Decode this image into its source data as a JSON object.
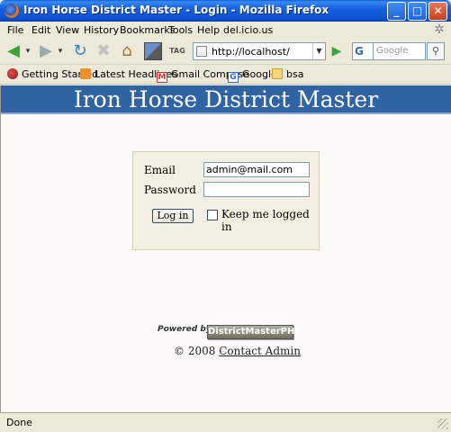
{
  "window": {
    "title": "Iron Horse District Master - Login - Mozilla Firefox",
    "minimize": "_",
    "maximize": "□",
    "close": "✕"
  },
  "menu": {
    "items": [
      {
        "label": "File",
        "accel": "F"
      },
      {
        "label": "Edit",
        "accel": "E"
      },
      {
        "label": "View",
        "accel": "V"
      },
      {
        "label": "History",
        "accel": "s"
      },
      {
        "label": "Bookmarks",
        "accel": "B"
      },
      {
        "label": "Tools",
        "accel": "T"
      },
      {
        "label": "Help",
        "accel": "H"
      },
      {
        "label": "del.icio.us",
        "accel": ""
      }
    ]
  },
  "navbar": {
    "url": "http://localhost/",
    "search_engine": "G",
    "search_placeholder": "Google",
    "tag_label": "TAG"
  },
  "bookmarks": [
    {
      "label": "Getting Started",
      "icon": "getting-started-icon"
    },
    {
      "label": "Latest Headlines",
      "icon": "rss-icon"
    },
    {
      "label": "Gmail Compose",
      "icon": "gmail-icon"
    },
    {
      "label": "Google",
      "icon": "google-icon"
    },
    {
      "label": "bsa",
      "icon": "folder-icon"
    }
  ],
  "page": {
    "banner_title": "Iron Horse District Master",
    "login": {
      "email_label": "Email",
      "email_value": "admin@mail.com",
      "password_label": "Password",
      "password_value": "",
      "login_button": "Log in",
      "remember_label": "Keep me logged in",
      "remember_checked": false
    },
    "powered_by": "Powered by",
    "product_badge": "DistrictMasterPHP",
    "copyright": "© 2008",
    "contact_link": "Contact Admin"
  },
  "status": {
    "text": "Done"
  },
  "colors": {
    "banner": "#2f63a4",
    "titlebar": "#1660e0",
    "page_bg": "#fbfaf6",
    "login_box": "#f3efe2"
  }
}
